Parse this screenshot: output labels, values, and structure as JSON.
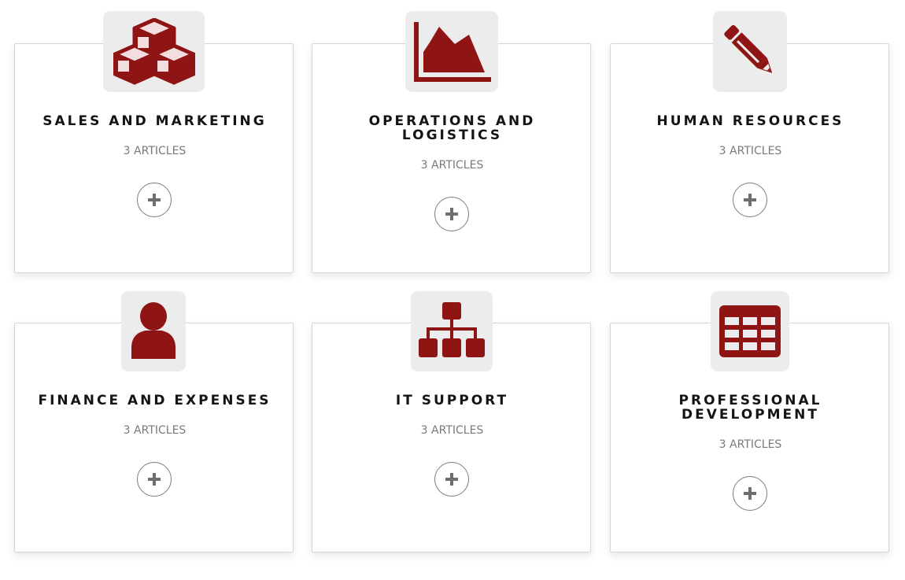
{
  "colors": {
    "accent": "#8f1414",
    "icon_bg": "#ececec",
    "title": "#141414",
    "muted": "#7a7a7a"
  },
  "categories": [
    {
      "title_lines": [
        "SALES AND MARKETING"
      ],
      "count_label": "3 ARTICLES",
      "icon": "cubes-icon"
    },
    {
      "title_lines": [
        "OPERATIONS AND",
        "LOGISTICS"
      ],
      "count_label": "3 ARTICLES",
      "icon": "area-chart-icon"
    },
    {
      "title_lines": [
        "HUMAN RESOURCES"
      ],
      "count_label": "3 ARTICLES",
      "icon": "pencil-icon"
    },
    {
      "title_lines": [
        "FINANCE AND EXPENSES"
      ],
      "count_label": "3 ARTICLES",
      "icon": "user-icon"
    },
    {
      "title_lines": [
        "IT SUPPORT"
      ],
      "count_label": "3 ARTICLES",
      "icon": "sitemap-icon"
    },
    {
      "title_lines": [
        "PROFESSIONAL",
        "DEVELOPMENT"
      ],
      "count_label": "3 ARTICLES",
      "icon": "table-icon"
    }
  ]
}
